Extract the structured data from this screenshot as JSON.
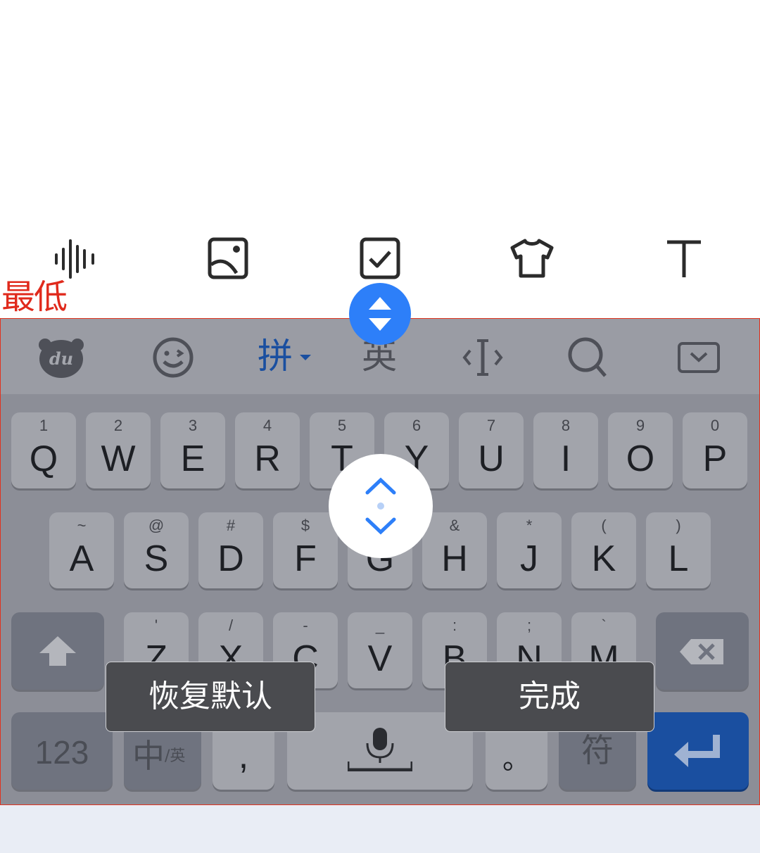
{
  "label_lowest": "最低",
  "toolbar": {
    "icons": [
      "voice-wave-icon",
      "image-icon",
      "checkbox-icon",
      "tshirt-icon",
      "text-icon"
    ]
  },
  "candidate_bar": {
    "icons": [
      "du-logo-icon",
      "emoji-icon",
      "pinyin-mode",
      "english-mode",
      "cursor-icon",
      "search-icon",
      "collapse-keyboard-icon"
    ],
    "pinyin_label": "拼",
    "english_label": "英"
  },
  "keys": {
    "row1": [
      {
        "main": "Q",
        "sub": "1"
      },
      {
        "main": "W",
        "sub": "2"
      },
      {
        "main": "E",
        "sub": "3"
      },
      {
        "main": "R",
        "sub": "4"
      },
      {
        "main": "T",
        "sub": "5"
      },
      {
        "main": "Y",
        "sub": "6"
      },
      {
        "main": "U",
        "sub": "7"
      },
      {
        "main": "I",
        "sub": "8"
      },
      {
        "main": "O",
        "sub": "9"
      },
      {
        "main": "P",
        "sub": "0"
      }
    ],
    "row2": [
      {
        "main": "A",
        "sub": "~"
      },
      {
        "main": "S",
        "sub": "@"
      },
      {
        "main": "D",
        "sub": "#"
      },
      {
        "main": "F",
        "sub": "$"
      },
      {
        "main": "G",
        "sub": "%"
      },
      {
        "main": "H",
        "sub": "&"
      },
      {
        "main": "J",
        "sub": "*"
      },
      {
        "main": "K",
        "sub": "("
      },
      {
        "main": "L",
        "sub": ")"
      }
    ],
    "row3": [
      {
        "main": "Z",
        "sub": "'"
      },
      {
        "main": "X",
        "sub": "/"
      },
      {
        "main": "C",
        "sub": "-"
      },
      {
        "main": "V",
        "sub": "_"
      },
      {
        "main": "B",
        "sub": ":"
      },
      {
        "main": "N",
        "sub": ";"
      },
      {
        "main": "M",
        "sub": "`"
      }
    ],
    "num_label": "123",
    "lang_main": "中",
    "lang_sub": "/英",
    "comma_main": ",",
    "comma_sub": "!",
    "period_main": "。",
    "period_sub": "?",
    "symbol_label": "符"
  },
  "overlay": {
    "reset_label": "恢复默认",
    "done_label": "完成"
  },
  "colors": {
    "accent_blue": "#2d7ff9",
    "enter_blue": "#1a4fa0",
    "frame_red": "#e0321e"
  }
}
